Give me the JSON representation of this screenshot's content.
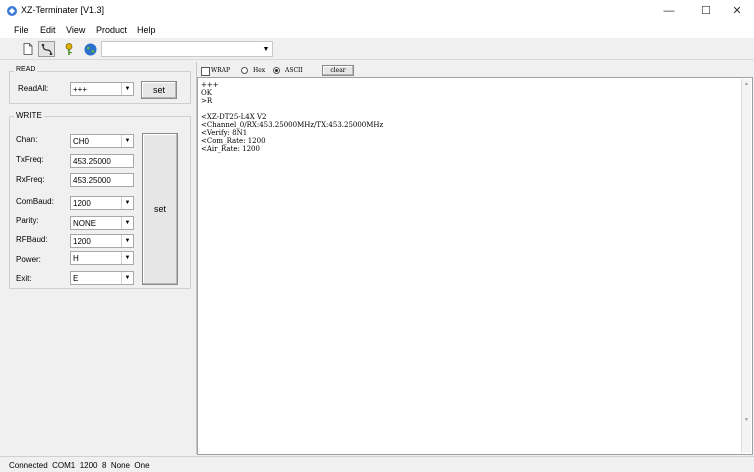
{
  "window": {
    "title": "XZ-Terminater [V1.3]",
    "controls": {
      "minimize": "—",
      "maximize": "☐",
      "close": "✕"
    }
  },
  "menu": [
    "File",
    "Edit",
    "View",
    "Product",
    "Help"
  ],
  "toolbar": {
    "icons": [
      "new-document-icon",
      "connect-icon",
      "key-icon",
      "globe-icon"
    ],
    "port_combo_value": ""
  },
  "read": {
    "group_label": "READ",
    "readall_label": "ReadAll:",
    "readall_value": "+++",
    "set_label": "set"
  },
  "write": {
    "group_label": "WRITE",
    "fields": [
      {
        "label": "Chan:",
        "value": "CH0",
        "type": "select"
      },
      {
        "label": "TxFreq:",
        "value": "453.25000",
        "type": "input"
      },
      {
        "label": "RxFreq:",
        "value": "453.25000",
        "type": "input"
      },
      {
        "label": "ComBaud:",
        "value": "1200",
        "type": "select"
      },
      {
        "label": "Parity:",
        "value": "NONE",
        "type": "select"
      },
      {
        "label": "RFBaud:",
        "value": "1200",
        "type": "select"
      },
      {
        "label": "Power:",
        "value": "H",
        "type": "select"
      },
      {
        "label": "Exit:",
        "value": "E",
        "type": "select"
      }
    ],
    "set_label": "set"
  },
  "terminal": {
    "wrap_label": "WRAP",
    "wrap_checked": false,
    "hex_label": "Hex",
    "ascii_label": "ASCII",
    "mode": "ASCII",
    "clear_label": "clear",
    "lines": [
      "+++",
      "OK",
      ">R",
      "",
      "<XZ-DT25-L4X V2",
      "<Channel_0/RX:453.25000MHz/TX:453.25000MHz",
      "<Verify: 8N1",
      "<Com_Rate: 1200",
      "<Air_Rate: 1200"
    ]
  },
  "status": "Connected  COM1  1200  8  None  One"
}
